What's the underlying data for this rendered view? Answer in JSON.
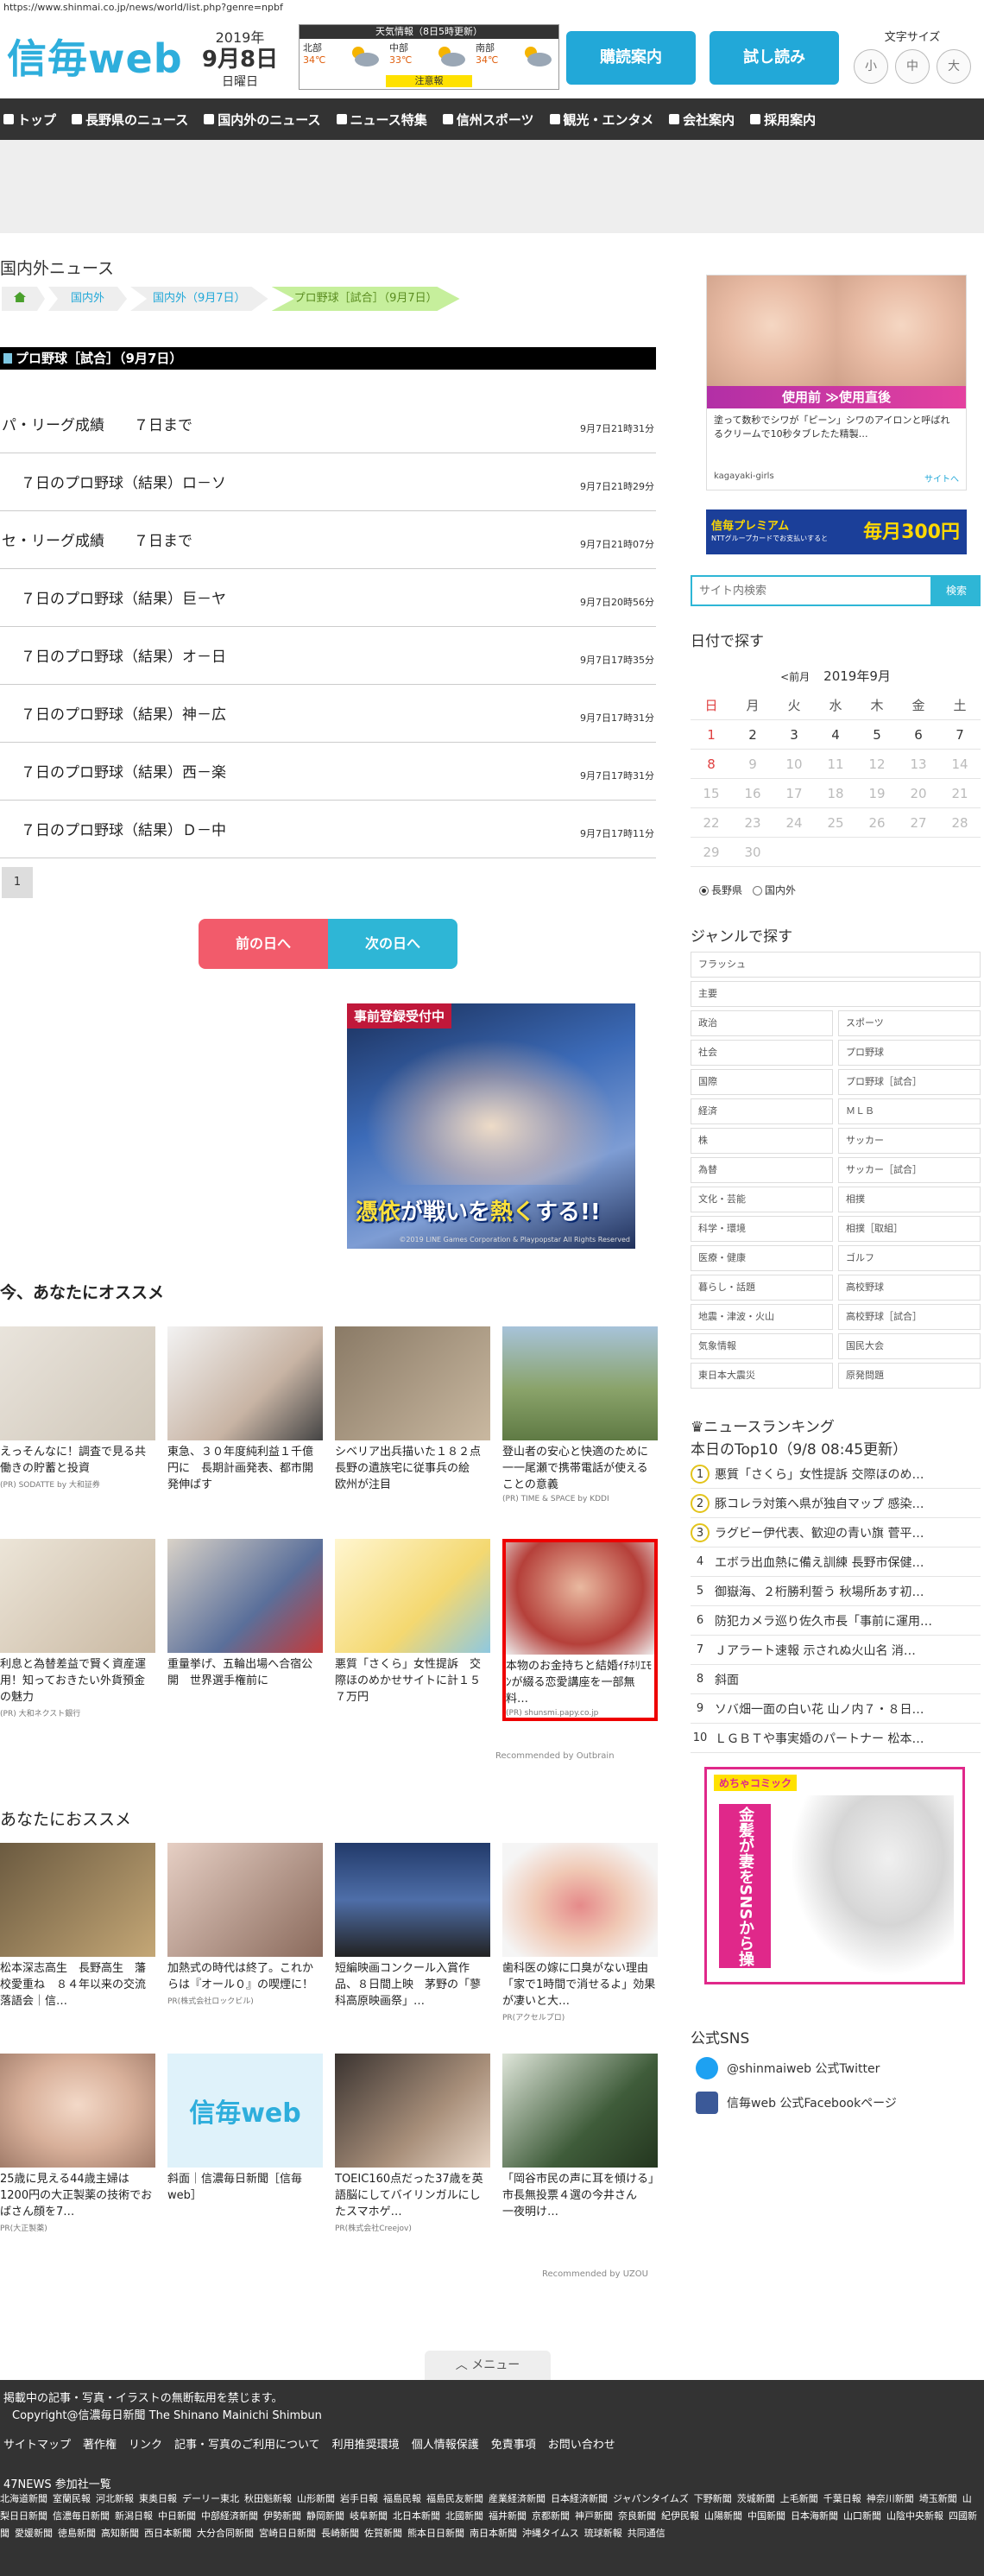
{
  "browser": {
    "url": "https://www.shinmai.co.jp/news/world/list.php?genre=npbf"
  },
  "header": {
    "logo": "信毎web",
    "year": "2019年",
    "month_day": "9月8日",
    "weekday": "日曜日",
    "weather": {
      "title": "天気情報（8日5時更新）",
      "regions": [
        {
          "name": "北部",
          "temp": "34℃"
        },
        {
          "name": "中部",
          "temp": "33℃"
        },
        {
          "name": "南部",
          "temp": "34℃"
        }
      ],
      "warning": "注意報"
    },
    "btn_subscribe": "購読案内",
    "btn_trial": "試し読み",
    "font_size_label": "文字サイズ",
    "font_sizes": [
      "小",
      "中",
      "大"
    ]
  },
  "nav": {
    "items": [
      "トップ",
      "長野県のニュース",
      "国内外のニュース",
      "ニュース特集",
      "信州スポーツ",
      "観光・エンタメ",
      "会社案内",
      "採用案内"
    ]
  },
  "main": {
    "section_title": "国内外ニュース",
    "breadcrumbs": [
      "国内外",
      "国内外（9月7日）",
      "プロ野球［試合］（9月7日）"
    ],
    "category": "プロ野球［試合］（9月7日）",
    "articles": [
      {
        "title": "パ・リーグ成績　　７日まで",
        "time": "9月7日21時31分",
        "indent": false
      },
      {
        "title": "７日のプロ野球（結果）ロ－ソ",
        "time": "9月7日21時29分",
        "indent": true
      },
      {
        "title": "セ・リーグ成績　　７日まで",
        "time": "9月7日21時07分",
        "indent": false
      },
      {
        "title": "７日のプロ野球（結果）巨－ヤ",
        "time": "9月7日20時56分",
        "indent": true
      },
      {
        "title": "７日のプロ野球（結果）オ－日",
        "time": "9月7日17時35分",
        "indent": true
      },
      {
        "title": "７日のプロ野球（結果）神－広",
        "time": "9月7日17時31分",
        "indent": true
      },
      {
        "title": "７日のプロ野球（結果）西－楽",
        "time": "9月7日17時31分",
        "indent": true
      },
      {
        "title": "７日のプロ野球（結果）Ｄ－中",
        "time": "9月7日17時11分",
        "indent": true
      }
    ],
    "page_number": "1",
    "prev_day": "前の日へ",
    "next_day": "次の日へ",
    "game_ad": {
      "ribbon": "事前登録受付中",
      "catch_a": "憑依",
      "catch_b": "が戦いを",
      "catch_c": "熱く",
      "catch_d": "する!!",
      "copy": "©2019 LINE Games Corporation & Playpopstar All Rights Reserved"
    },
    "osusume_title": "今、あなたにオススメ",
    "osusume": [
      {
        "caption": "えっそんなに！調査で見る共働きの貯蓄と投資",
        "source": "(PR) SODATTE by 大和証券"
      },
      {
        "caption": "東急、３０年度純利益１千億円に　長期計画発表、都市開発伸ばす",
        "source": ""
      },
      {
        "caption": "シベリア出兵描いた１８２点　長野の遺族宅に従事兵の絵　欧州が注目",
        "source": ""
      },
      {
        "caption": "登山者の安心と快適のために一一尾瀬で携帯電話が使えることの意義",
        "source": "(PR) TIME & SPACE by KDDI"
      },
      {
        "caption": "利息と為替差益で賢く資産運用！知っておきたい外貨預金の魅力",
        "source": "(PR) 大和ネクスト銀行"
      },
      {
        "caption": "重量挙げ、五輪出場へ合宿公開　世界選手権前に",
        "source": ""
      },
      {
        "caption": "悪質「さくら」女性提訴　交際ほのめかせサイトに計１５７万円",
        "source": ""
      },
      {
        "caption": "本物のお金持ちと結婚ｲﾁﾎﾘｴﾓﾝが綴る恋愛講座を一部無料…",
        "source": "(PR) shunsmi.papy.co.jp"
      }
    ],
    "recommended_by_1": "Recommended by Outbrain",
    "anata_title": "あなたにおススメ",
    "anata": [
      {
        "caption": "松本深志高生　長野高生　藩校愛重ね　８４年以来の交流落語会｜信…",
        "source": ""
      },
      {
        "caption": "加熱式の時代は終了。これからは『オール０』の喫煙に！",
        "source": "PR(株式会社ロックビル)"
      },
      {
        "caption": "短編映画コンクール入賞作品、８日間上映　茅野の「蓼科高原映画祭」…",
        "source": ""
      },
      {
        "caption": "歯科医の嫁に口臭がない理由「家で1時間で消せるよ」効果が凄いと大…",
        "source": "PR(アクセルプロ)"
      },
      {
        "caption": "25歳に見える44歳主婦は1200円の大正製薬の技術でおばさん顔を7…",
        "source": "PR(大正製薬)"
      },
      {
        "caption": "斜面｜信濃毎日新聞［信毎web］",
        "source": ""
      },
      {
        "caption": "TOEIC160点だった37歳を英語脳にしてバイリンガルにしたスマホゲ…",
        "source": "PR(株式会社Creejov)"
      },
      {
        "caption": "「岡谷市民の声に耳を傾ける」　市長無投票４選の今井さん　一夜明け…",
        "source": ""
      }
    ],
    "recommended_by_2": "Recommended by UZOU",
    "menu_tab": "メニュー"
  },
  "side": {
    "ad1": {
      "band": "使用前 ≫使用直後",
      "text": "塗って数秒でシワが「ピーン」シワのアイロンと呼ばれるクリームで10秒タブレたた精製…",
      "source": "kagayaki-girls",
      "go": "サイトへ"
    },
    "ad2": {
      "a": "信毎プレミアム",
      "b": "NTTグループカードでお支払いすると",
      "c": "毎月300円"
    },
    "search_placeholder": "サイト内検索",
    "search_btn": "検索",
    "date_title": "日付で探す",
    "cal_prev": "<前月",
    "cal_ym": "2019年9月",
    "weekdays": [
      "日",
      "月",
      "火",
      "水",
      "木",
      "金",
      "土"
    ],
    "calendar": [
      [
        "1",
        "2",
        "3",
        "4",
        "5",
        "6",
        "7"
      ],
      [
        "8",
        "9",
        "10",
        "11",
        "12",
        "13",
        "14"
      ],
      [
        "15",
        "16",
        "17",
        "18",
        "19",
        "20",
        "21"
      ],
      [
        "22",
        "23",
        "24",
        "25",
        "26",
        "27",
        "28"
      ],
      [
        "29",
        "30",
        "",
        "",
        "",
        "",
        ""
      ]
    ],
    "radio_local": "長野県",
    "radio_world": "国内外",
    "genre_title": "ジャンルで探す",
    "genre_full": [
      "フラッシュ",
      "主要"
    ],
    "genres": [
      "政治",
      "スポーツ",
      "社会",
      "プロ野球",
      "国際",
      "プロ野球［試合］",
      "経済",
      "ＭＬＢ",
      "株",
      "サッカー",
      "為替",
      "サッカー［試合］",
      "文化・芸能",
      "相撲",
      "科学・環境",
      "相撲［取組］",
      "医療・健康",
      "ゴルフ",
      "暮らし・話題",
      "高校野球",
      "地震・津波・火山",
      "高校野球［試合］",
      "気象情報",
      "国民大会",
      "東日本大震災",
      "原発問題"
    ],
    "ranking_title": "ニュースランキング",
    "ranking_sub": "本日のTop10（9/8 08:45更新）",
    "ranking": [
      "悪質「さくら」女性提訴 交際ほのめ…",
      "豚コレラ対策へ県が独自マップ 感染…",
      "ラグビー伊代表、歓迎の青い旗 菅平…",
      "エボラ出血熱に備え訓練 長野市保健…",
      "御嶽海、２桁勝利誓う 秋場所あす初…",
      "防犯カメラ巡り佐久市長「事前に運用…",
      "Ｊアラート速報 示されぬ火山名 消…",
      "斜面",
      "ソバ畑一面の白い花 山ノ内７・８日…",
      "ＬＧＢＴや事実婚のパートナー 松本…"
    ],
    "comic_tag": "めちゃコミック",
    "comic_vert": "金髪が妻をSNSから操っているおかげ",
    "sns_title": "公式SNS",
    "sns_twitter": "@shinmaiweb 公式Twitter",
    "sns_facebook": "信毎web 公式Facebookページ"
  },
  "footer": {
    "notice": "掲載中の記事・写真・イラストの無断転用を禁じます。",
    "copyright": "Copyright@信濃毎日新聞 The Shinano Mainichi Shimbun",
    "links": [
      "サイトマップ",
      "著作権",
      "リンク",
      "記事・写真のご利用について",
      "利用推奨環境",
      "個人情報保護",
      "免責事項",
      "お問い合わせ"
    ],
    "partners_title": "47NEWS 参加社一覧",
    "partners": [
      "北海道新聞",
      "室蘭民報",
      "河北新報",
      "東奥日報",
      "デーリー東北",
      "秋田魁新報",
      "山形新聞",
      "岩手日報",
      "福島民報",
      "福島民友新聞",
      "産業経済新聞",
      "日本経済新聞",
      "ジャパンタイムズ",
      "下野新聞",
      "茨城新聞",
      "上毛新聞",
      "千葉日報",
      "神奈川新聞",
      "埼玉新聞",
      "山梨日日新聞",
      "信濃毎日新聞",
      "新潟日報",
      "中日新聞",
      "中部経済新聞",
      "伊勢新聞",
      "静岡新聞",
      "岐阜新聞",
      "北日本新聞",
      "北國新聞",
      "福井新聞",
      "京都新聞",
      "神戸新聞",
      "奈良新聞",
      "紀伊民報",
      "山陽新聞",
      "中国新聞",
      "日本海新聞",
      "山口新聞",
      "山陰中央新報",
      "四國新聞",
      "愛媛新聞",
      "徳島新聞",
      "高知新聞",
      "西日本新聞",
      "大分合同新聞",
      "宮崎日日新聞",
      "長崎新聞",
      "佐賀新聞",
      "熊本日日新聞",
      "南日本新聞",
      "沖縄タイムス",
      "琉球新報",
      "共同通信"
    ]
  },
  "colors": {
    "brand": "#2eaedc",
    "nav": "#333333",
    "prev": "#f25b6b",
    "next": "#2eb6d6"
  }
}
